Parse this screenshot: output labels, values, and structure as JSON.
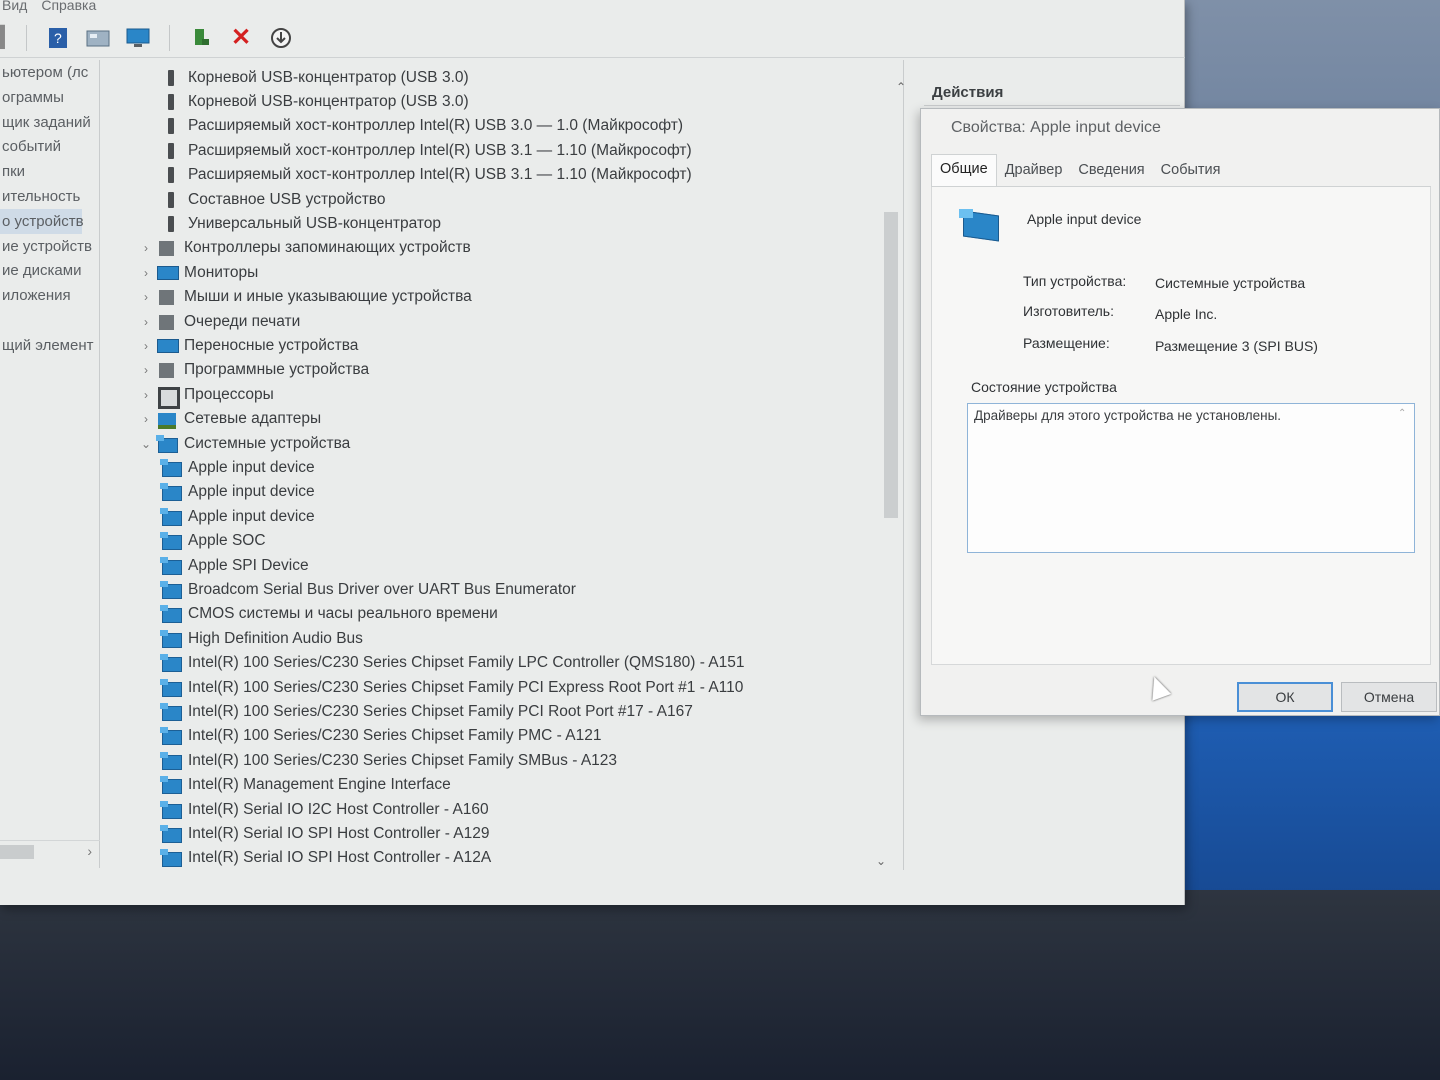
{
  "menubar": {
    "items": [
      "Вид",
      "Справка"
    ]
  },
  "toolbar": {
    "icons": [
      "help-icon",
      "properties-icon",
      "monitor-icon",
      "enable-device-icon",
      "uninstall-icon",
      "update-driver-icon"
    ]
  },
  "left_nav": {
    "items": [
      {
        "label": "ьютером (лс",
        "selected": false
      },
      {
        "label": "ограммы",
        "selected": false
      },
      {
        "label": "щик заданий",
        "selected": false
      },
      {
        "label": "событий",
        "selected": false
      },
      {
        "label": "пки",
        "selected": false
      },
      {
        "label": "ительность",
        "selected": false
      },
      {
        "label": "о устройств",
        "selected": true
      },
      {
        "label": "ие устройств",
        "selected": false
      },
      {
        "label": "ие дисками",
        "selected": false
      },
      {
        "label": "иложения",
        "selected": false
      },
      {
        "label": "",
        "selected": false
      },
      {
        "label": "щий элемент",
        "selected": false
      }
    ]
  },
  "device_tree": {
    "rows": [
      {
        "label": "Корневой USB-концентратор (USB 3.0)",
        "level": 2,
        "icon": "usb-icon",
        "expander": ""
      },
      {
        "label": "Корневой USB-концентратор (USB 3.0)",
        "level": 2,
        "icon": "usb-icon",
        "expander": ""
      },
      {
        "label": "Расширяемый хост-контроллер Intel(R) USB 3.0 — 1.0 (Майкрософт)",
        "level": 2,
        "icon": "usb-icon",
        "expander": ""
      },
      {
        "label": "Расширяемый хост-контроллер Intel(R) USB 3.1 — 1.10 (Майкрософт)",
        "level": 2,
        "icon": "usb-icon",
        "expander": ""
      },
      {
        "label": "Расширяемый хост-контроллер Intel(R) USB 3.1 — 1.10 (Майкрософт)",
        "level": 2,
        "icon": "usb-icon",
        "expander": ""
      },
      {
        "label": "Составное USB устройство",
        "level": 2,
        "icon": "usb-icon",
        "expander": ""
      },
      {
        "label": "Универсальный USB-концентратор",
        "level": 2,
        "icon": "usb-icon",
        "expander": ""
      },
      {
        "label": "Контроллеры запоминающих устройств",
        "level": 1,
        "icon": "storage-icon",
        "expander": "›"
      },
      {
        "label": "Мониторы",
        "level": 1,
        "icon": "monitor-icon",
        "expander": "›"
      },
      {
        "label": "Мыши и иные указывающие устройства",
        "level": 1,
        "icon": "mouse-icon",
        "expander": "›"
      },
      {
        "label": "Очереди печати",
        "level": 1,
        "icon": "printer-icon",
        "expander": "›"
      },
      {
        "label": "Переносные устройства",
        "level": 1,
        "icon": "portable-device-icon",
        "expander": "›"
      },
      {
        "label": "Программные устройства",
        "level": 1,
        "icon": "software-device-icon",
        "expander": "›"
      },
      {
        "label": "Процессоры",
        "level": 1,
        "icon": "processor-icon",
        "expander": "›"
      },
      {
        "label": "Сетевые адаптеры",
        "level": 1,
        "icon": "network-adapter-icon",
        "expander": "›"
      },
      {
        "label": "Системные устройства",
        "level": 1,
        "icon": "system-device-icon",
        "expander": "⌄"
      },
      {
        "label": "Apple input device",
        "level": 2,
        "icon": "system-device-icon",
        "expander": ""
      },
      {
        "label": "Apple input device",
        "level": 2,
        "icon": "system-device-icon",
        "expander": ""
      },
      {
        "label": "Apple input device",
        "level": 2,
        "icon": "system-device-icon",
        "expander": ""
      },
      {
        "label": "Apple SOC",
        "level": 2,
        "icon": "system-device-icon",
        "expander": ""
      },
      {
        "label": "Apple SPI Device",
        "level": 2,
        "icon": "system-device-icon",
        "expander": ""
      },
      {
        "label": "Broadcom Serial Bus Driver over UART Bus Enumerator",
        "level": 2,
        "icon": "system-device-icon",
        "expander": ""
      },
      {
        "label": "CMOS системы и часы реального времени",
        "level": 2,
        "icon": "system-device-icon",
        "expander": ""
      },
      {
        "label": "High Definition Audio Bus",
        "level": 2,
        "icon": "system-device-icon",
        "expander": ""
      },
      {
        "label": "Intel(R) 100 Series/C230 Series Chipset Family LPC Controller (QMS180) - A151",
        "level": 2,
        "icon": "system-device-icon",
        "expander": ""
      },
      {
        "label": "Intel(R) 100 Series/C230 Series Chipset Family PCI Express Root Port #1 - A110",
        "level": 2,
        "icon": "system-device-icon",
        "expander": ""
      },
      {
        "label": "Intel(R) 100 Series/C230 Series Chipset Family PCI Root Port #17 - A167",
        "level": 2,
        "icon": "system-device-icon",
        "expander": ""
      },
      {
        "label": "Intel(R) 100 Series/C230 Series Chipset Family PMC - A121",
        "level": 2,
        "icon": "system-device-icon",
        "expander": ""
      },
      {
        "label": "Intel(R) 100 Series/C230 Series Chipset Family SMBus - A123",
        "level": 2,
        "icon": "system-device-icon",
        "expander": ""
      },
      {
        "label": "Intel(R) Management Engine Interface",
        "level": 2,
        "icon": "system-device-icon",
        "expander": ""
      },
      {
        "label": "Intel(R) Serial IO I2C Host Controller - A160",
        "level": 2,
        "icon": "system-device-icon",
        "expander": ""
      },
      {
        "label": "Intel(R) Serial IO SPI Host Controller - A129",
        "level": 2,
        "icon": "system-device-icon",
        "expander": ""
      },
      {
        "label": "Intel(R) Serial IO SPI Host Controller - A12A",
        "level": 2,
        "icon": "system-device-icon",
        "expander": ""
      }
    ]
  },
  "actions_pane": {
    "header": "Действия"
  },
  "dialog": {
    "title": "Свойства: Apple input device",
    "tabs": [
      {
        "label": "Общие",
        "active": true
      },
      {
        "label": "Драйвер",
        "active": false
      },
      {
        "label": "Сведения",
        "active": false
      },
      {
        "label": "События",
        "active": false
      }
    ],
    "device_name": "Apple input device",
    "properties": [
      {
        "label": "Тип устройства:",
        "value": "Системные устройства"
      },
      {
        "label": "Изготовитель:",
        "value": "Apple Inc."
      },
      {
        "label": "Размещение:",
        "value": "Размещение 3 (SPI BUS)"
      }
    ],
    "status_group_label": "Состояние устройства",
    "status_text": "Драйверы для этого устройства не установлены.",
    "ok_label": "ОК",
    "cancel_label": "Отмена"
  },
  "colors": {
    "accent": "#2a86c8",
    "ok_border": "#4a8fd6",
    "selection": "#cfdbe7"
  }
}
